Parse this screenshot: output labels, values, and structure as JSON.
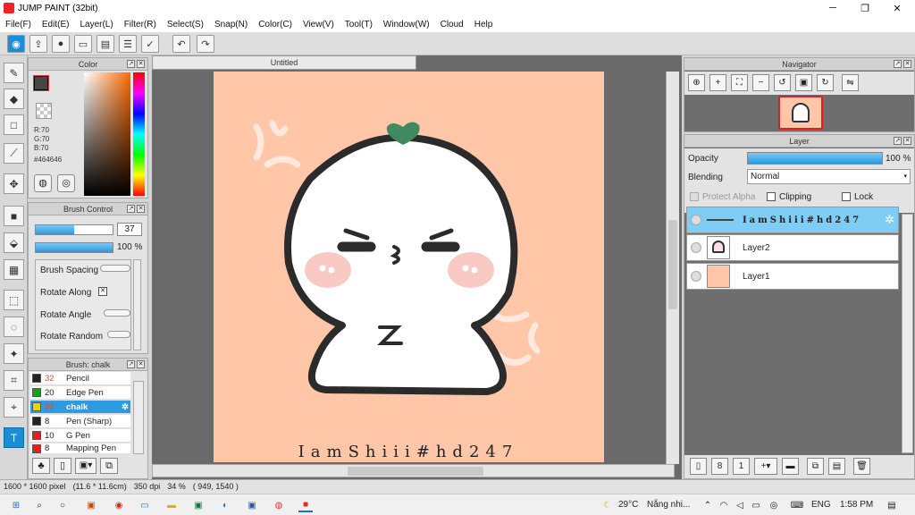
{
  "window": {
    "title": "JUMP PAINT (32bit)",
    "minimize": "─",
    "maximize": "❐",
    "close": "✕"
  },
  "menu": [
    "File(F)",
    "Edit(E)",
    "Layer(L)",
    "Filter(R)",
    "Select(S)",
    "Snap(N)",
    "Color(C)",
    "View(V)",
    "Tool(T)",
    "Window(W)",
    "Cloud",
    "Help"
  ],
  "color_panel": {
    "title": "Color",
    "r": "R:70",
    "g": "G:70",
    "b": "B:70",
    "hex": "#464646",
    "fg": "#464646",
    "bg": "#ffc7a8"
  },
  "brush_control": {
    "title": "Brush Control",
    "size": "37",
    "opacity": "100 %",
    "size_fill": 0.5,
    "opacity_fill": 1.0,
    "options": [
      "Brush Spacing",
      "Rotate Along",
      "Rotate Angle",
      "Rotate Random"
    ]
  },
  "brush_list": {
    "title": "Brush: chalk",
    "items": [
      {
        "size": "32",
        "name": "Pencil",
        "color": "#222222",
        "selected": false
      },
      {
        "size": "20",
        "name": "Edge Pen",
        "color": "#17a11a",
        "selected": false
      },
      {
        "size": "37",
        "name": "chalk",
        "color": "#e8d400",
        "selected": true
      },
      {
        "size": "8",
        "name": "Pen (Sharp)",
        "color": "#222222",
        "selected": false
      },
      {
        "size": "10",
        "name": "G Pen",
        "color": "#e02020",
        "selected": false
      },
      {
        "size": "8",
        "name": "Mapping Pen",
        "color": "#e02020",
        "selected": false
      }
    ]
  },
  "document": {
    "tab": "Untitled",
    "watermark": "IamShiii#hd247",
    "bg": "#ffc7a8"
  },
  "navigator": {
    "title": "Navigator"
  },
  "layer_panel": {
    "title": "Layer",
    "opacity_label": "Opacity",
    "opacity_value": "100 %",
    "opacity_fill": 1.0,
    "blending_label": "Blending",
    "blending_value": "Normal",
    "protect_alpha": "Protect Alpha",
    "clipping": "Clipping",
    "lock": "Lock",
    "layers": [
      {
        "name": "IamShiii#hd247",
        "selected": true,
        "kind": "text"
      },
      {
        "name": "Layer2",
        "selected": false,
        "kind": "image"
      },
      {
        "name": "Layer1",
        "selected": false,
        "kind": "fill"
      }
    ]
  },
  "status": {
    "size": "1600 * 1600 pixel",
    "cm": "(11.6 * 11.6cm)",
    "dpi": "350 dpi",
    "zoom": "34 %",
    "coords": "( 949, 1540 )"
  },
  "taskbar": {
    "weather": "29°C",
    "weather_text": "Nắng nhi...",
    "lang": "ENG",
    "time": "1:58 PM"
  }
}
